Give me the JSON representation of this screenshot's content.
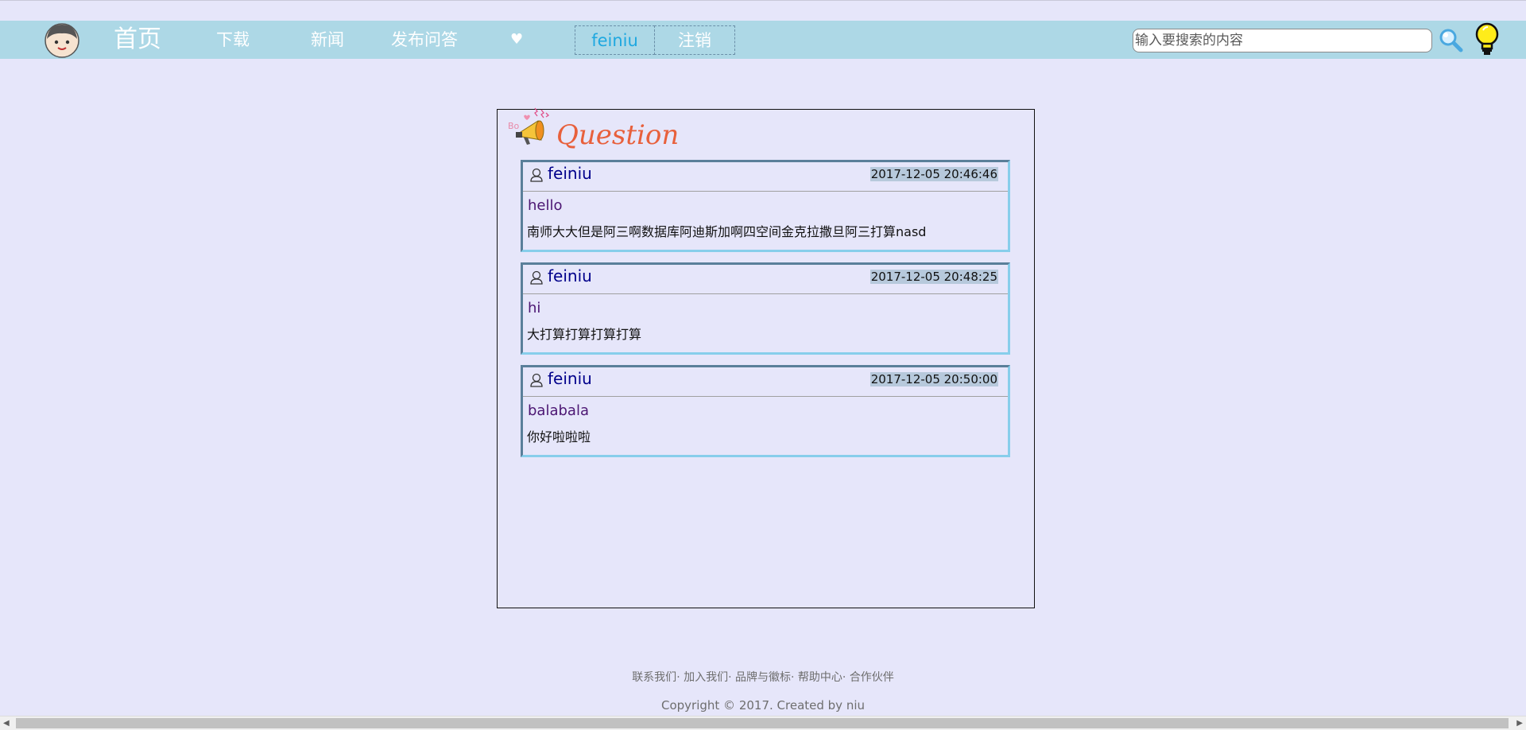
{
  "nav": {
    "home": "首页",
    "download": "下载",
    "news": "新闻",
    "qa": "发布问答",
    "heart": "♥",
    "username": "feiniu",
    "logout": "注销",
    "search_placeholder": "输入要搜索的内容"
  },
  "page": {
    "title": "Question"
  },
  "questions": [
    {
      "user": "feiniu",
      "time": "2017-12-05 20:46:46",
      "title": "hello",
      "body": "南师大大但是阿三啊数据库阿迪斯加啊四空间金克拉撒旦阿三打算nasd"
    },
    {
      "user": "feiniu",
      "time": "2017-12-05 20:48:25",
      "title": "hi",
      "body": "大打算打算打算打算"
    },
    {
      "user": "feiniu",
      "time": "2017-12-05 20:50:00",
      "title": "balabala",
      "body": "你好啦啦啦"
    }
  ],
  "footer": {
    "links": [
      "联系我们",
      "加入我们",
      "品牌与徽标",
      "帮助中心",
      "合作伙伴"
    ],
    "separator": "· ",
    "copyright": "Copyright © 2017. Created by niu"
  },
  "colors": {
    "background": "#e6e6fa",
    "navbar": "#add8e6",
    "title_accent": "#e8603c",
    "username_blue": "#00008b"
  }
}
